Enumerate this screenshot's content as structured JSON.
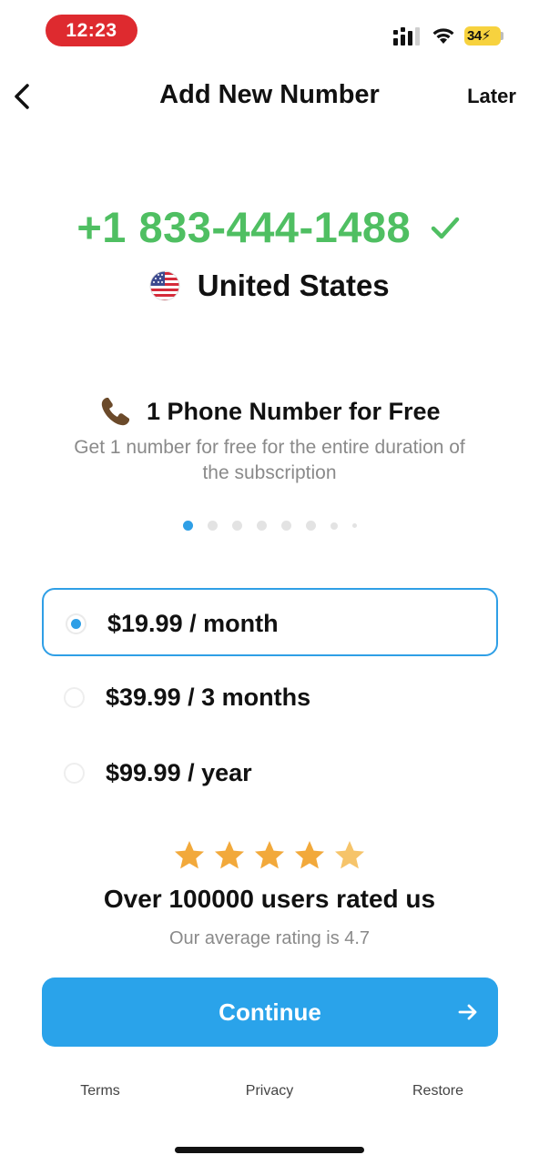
{
  "status_bar": {
    "time": "12:23",
    "battery": "34",
    "icons": [
      "signal-icon",
      "wifi-icon",
      "battery-icon"
    ]
  },
  "nav": {
    "title": "Add New Number",
    "later_label": "Later",
    "back_icon": "chevron-left-icon"
  },
  "number": {
    "value": "+1 833-444-1488",
    "country": "United States",
    "verified_icon": "check-icon",
    "flag_icon": "us-flag-icon"
  },
  "feature": {
    "icon": "telephone-icon",
    "title": "1 Phone Number for Free",
    "description": "Get 1 number for free for the entire duration of the subscription",
    "page_count": 8,
    "active_page": 1
  },
  "plans": [
    {
      "label": "$19.99 / month",
      "selected": true
    },
    {
      "label": "$39.99 / 3 months",
      "selected": false
    },
    {
      "label": "$99.99 / year",
      "selected": false
    }
  ],
  "rating": {
    "stars": 5,
    "title": "Over 100000 users rated us",
    "subtitle": "Our average rating is 4.7"
  },
  "cta": {
    "label": "Continue",
    "icon": "arrow-right-icon"
  },
  "footer": {
    "terms": "Terms",
    "privacy": "Privacy",
    "restore": "Restore"
  },
  "colors": {
    "accent": "#2aa3ea",
    "number_green": "#4fbf62",
    "time_pill": "#de2a2f",
    "star": "#f2a93b"
  }
}
